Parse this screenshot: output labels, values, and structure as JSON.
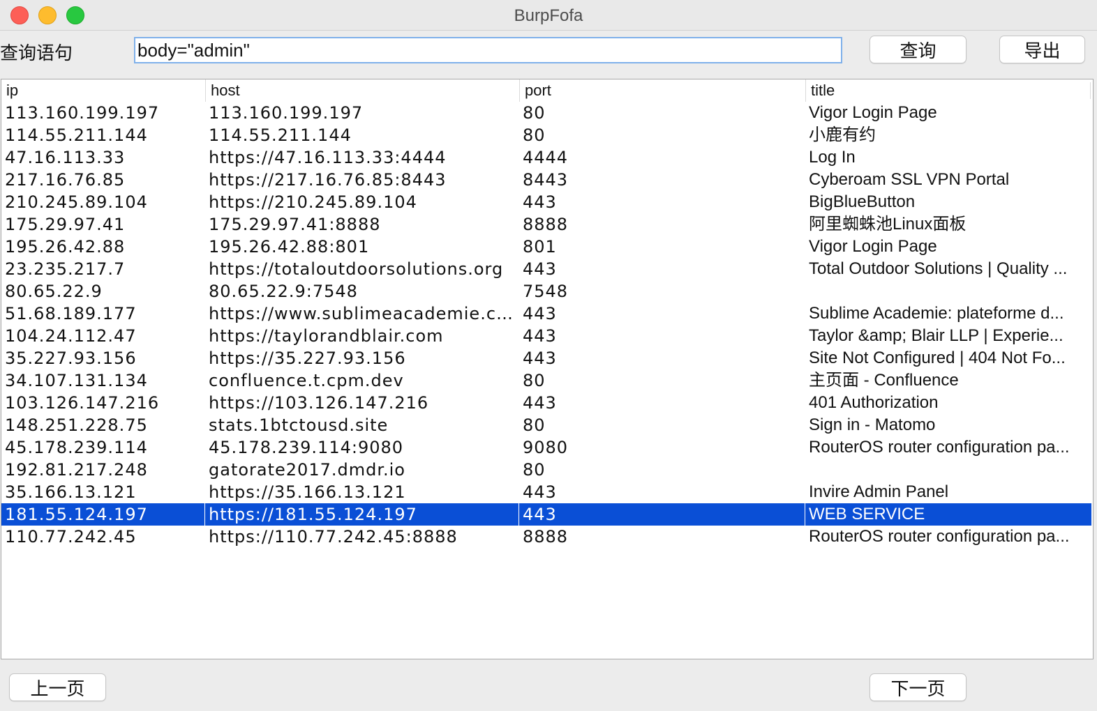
{
  "window": {
    "title": "BurpFofa"
  },
  "query": {
    "label": "查询语句",
    "value": "body=\"admin\"",
    "search_button": "查询",
    "export_button": "导出"
  },
  "table": {
    "columns": [
      "ip",
      "host",
      "port",
      "title"
    ],
    "selected_row": 18,
    "rows": [
      {
        "ip": "113.160.199.197",
        "host": "113.160.199.197",
        "port": "80",
        "title": "Vigor Login Page"
      },
      {
        "ip": "114.55.211.144",
        "host": "114.55.211.144",
        "port": "80",
        "title": "小鹿有约"
      },
      {
        "ip": "47.16.113.33",
        "host": "https://47.16.113.33:4444",
        "port": "4444",
        "title": "Log In"
      },
      {
        "ip": "217.16.76.85",
        "host": "https://217.16.76.85:8443",
        "port": "8443",
        "title": "Cyberoam SSL VPN Portal"
      },
      {
        "ip": "210.245.89.104",
        "host": "https://210.245.89.104",
        "port": "443",
        "title": "BigBlueButton"
      },
      {
        "ip": "175.29.97.41",
        "host": "175.29.97.41:8888",
        "port": "8888",
        "title": "阿里蜘蛛池Linux面板"
      },
      {
        "ip": "195.26.42.88",
        "host": "195.26.42.88:801",
        "port": "801",
        "title": "Vigor Login Page"
      },
      {
        "ip": "23.235.217.7",
        "host": "https://totaloutdoorsolutions.org",
        "port": "443",
        "title": "Total Outdoor Solutions | Quality ..."
      },
      {
        "ip": "80.65.22.9",
        "host": "80.65.22.9:7548",
        "port": "7548",
        "title": ""
      },
      {
        "ip": "51.68.189.177",
        "host": "https://www.sublimeacademie.com",
        "port": "443",
        "title": "Sublime Academie: plateforme d..."
      },
      {
        "ip": "104.24.112.47",
        "host": "https://taylorandblair.com",
        "port": "443",
        "title": "Taylor &amp; Blair LLP | Experie..."
      },
      {
        "ip": "35.227.93.156",
        "host": "https://35.227.93.156",
        "port": "443",
        "title": "Site Not Configured | 404 Not Fo..."
      },
      {
        "ip": "34.107.131.134",
        "host": "confluence.t.cpm.dev",
        "port": "80",
        "title": "主页面 - Confluence"
      },
      {
        "ip": "103.126.147.216",
        "host": "https://103.126.147.216",
        "port": "443",
        "title": "401 Authorization"
      },
      {
        "ip": "148.251.228.75",
        "host": "stats.1btctousd.site",
        "port": "80",
        "title": "Sign in - Matomo"
      },
      {
        "ip": "45.178.239.114",
        "host": "45.178.239.114:9080",
        "port": "9080",
        "title": "RouterOS router configuration pa..."
      },
      {
        "ip": "192.81.217.248",
        "host": "gatorate2017.dmdr.io",
        "port": "80",
        "title": ""
      },
      {
        "ip": "35.166.13.121",
        "host": "https://35.166.13.121",
        "port": "443",
        "title": "Invire Admin Panel"
      },
      {
        "ip": "181.55.124.197",
        "host": "https://181.55.124.197",
        "port": "443",
        "title": "WEB SERVICE"
      },
      {
        "ip": "110.77.242.45",
        "host": "https://110.77.242.45:8888",
        "port": "8888",
        "title": "RouterOS router configuration pa..."
      }
    ]
  },
  "pagination": {
    "prev_button": "上一页",
    "next_button": "下一页"
  },
  "colors": {
    "selection": "#0a4fd6",
    "input_focus_border": "#7fb0ea"
  }
}
